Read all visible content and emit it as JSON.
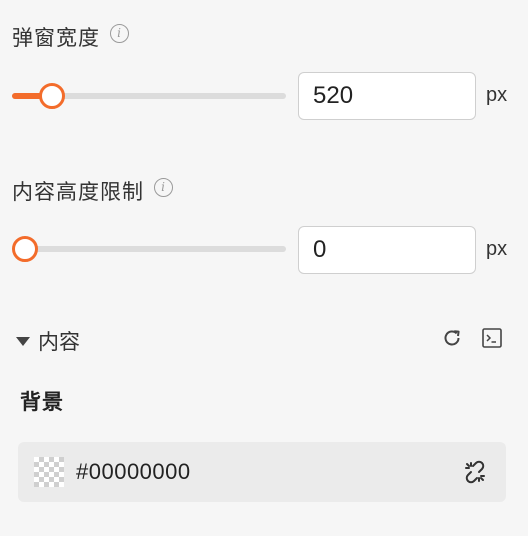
{
  "width_field": {
    "label": "弹窗宽度",
    "value": "520",
    "unit": "px",
    "slider_fraction": 0.1
  },
  "height_field": {
    "label": "内容高度限制",
    "value": "0",
    "unit": "px",
    "slider_fraction": 0
  },
  "content_section": {
    "title": "内容",
    "background_label": "背景",
    "background_color": "#00000000"
  },
  "colors": {
    "accent": "#f36c2b"
  }
}
